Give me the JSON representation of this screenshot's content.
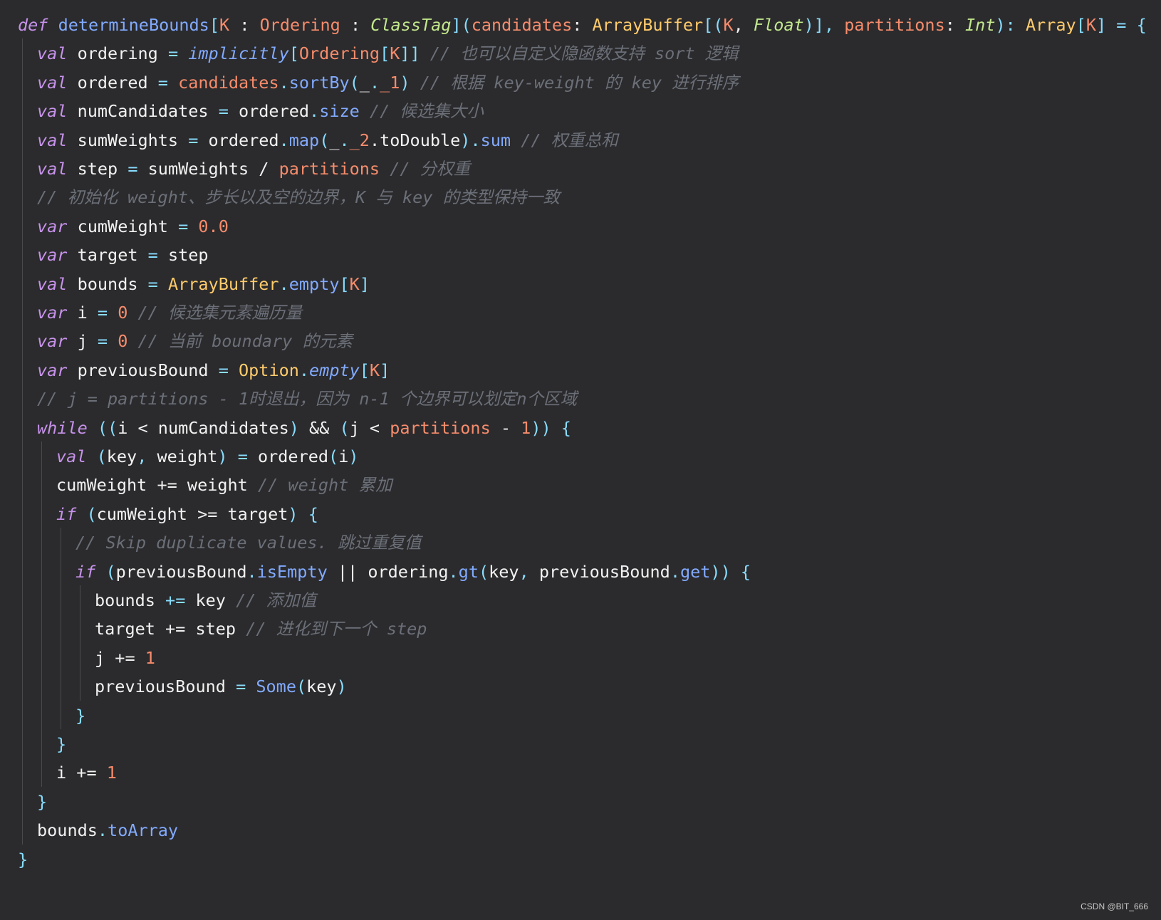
{
  "colors": {
    "background": "#2b2b2d",
    "plain": "#f2f2f2",
    "keyword": "#c792ea",
    "function": "#82aaff",
    "param": "#f78c6c",
    "type": "#ffcb6b",
    "classtag": "#c3e88d",
    "operator": "#89ddff",
    "number": "#f78c6c",
    "comment": "#6b6f78"
  },
  "code": {
    "lines": [
      {
        "indent": 0,
        "tokens": [
          {
            "t": "def",
            "c": "def"
          },
          {
            "t": " ",
            "c": "plain"
          },
          {
            "t": "determineBounds",
            "c": "fn"
          },
          {
            "t": "[",
            "c": "punc"
          },
          {
            "t": "K",
            "c": "param"
          },
          {
            "t": " : ",
            "c": "plain"
          },
          {
            "t": "Ordering",
            "c": "param"
          },
          {
            "t": " : ",
            "c": "plain"
          },
          {
            "t": "ClassTag",
            "c": "classtag"
          },
          {
            "t": "](",
            "c": "punc"
          },
          {
            "t": "candidates",
            "c": "param"
          },
          {
            "t": ": ",
            "c": "plain"
          },
          {
            "t": "ArrayBuffer",
            "c": "type"
          },
          {
            "t": "[(",
            "c": "punc"
          },
          {
            "t": "K",
            "c": "param"
          },
          {
            "t": ", ",
            "c": "plain"
          },
          {
            "t": "Float",
            "c": "classtag"
          },
          {
            "t": ")], ",
            "c": "punc"
          },
          {
            "t": "partitions",
            "c": "param"
          },
          {
            "t": ": ",
            "c": "plain"
          },
          {
            "t": "Int",
            "c": "classtag"
          },
          {
            "t": "): ",
            "c": "punc"
          },
          {
            "t": "Array",
            "c": "type"
          },
          {
            "t": "[",
            "c": "punc"
          },
          {
            "t": "K",
            "c": "param"
          },
          {
            "t": "] = {",
            "c": "punc"
          }
        ]
      },
      {
        "indent": 1,
        "tokens": [
          {
            "t": "val",
            "c": "keyword"
          },
          {
            "t": " ordering ",
            "c": "plain"
          },
          {
            "t": "=",
            "c": "op"
          },
          {
            "t": " ",
            "c": "plain"
          },
          {
            "t": "implicitly",
            "c": "methodi"
          },
          {
            "t": "[",
            "c": "punc"
          },
          {
            "t": "Ordering",
            "c": "param"
          },
          {
            "t": "[",
            "c": "punc"
          },
          {
            "t": "K",
            "c": "param"
          },
          {
            "t": "]]",
            "c": "punc"
          },
          {
            "t": " // 也可以自定义隐函数支持 sort 逻辑",
            "c": "comment"
          }
        ]
      },
      {
        "indent": 1,
        "tokens": [
          {
            "t": "val",
            "c": "keyword"
          },
          {
            "t": " ordered ",
            "c": "plain"
          },
          {
            "t": "=",
            "c": "op"
          },
          {
            "t": " ",
            "c": "plain"
          },
          {
            "t": "candidates",
            "c": "param"
          },
          {
            "t": ".",
            "c": "punc"
          },
          {
            "t": "sortBy",
            "c": "method"
          },
          {
            "t": "(",
            "c": "punc"
          },
          {
            "t": "_",
            "c": "plain"
          },
          {
            "t": ".",
            "c": "punc"
          },
          {
            "t": "_1",
            "c": "number"
          },
          {
            "t": ")",
            "c": "punc"
          },
          {
            "t": " // 根据 key-weight 的 key 进行排序",
            "c": "comment"
          }
        ]
      },
      {
        "indent": 1,
        "tokens": [
          {
            "t": "val",
            "c": "keyword"
          },
          {
            "t": " numCandidates ",
            "c": "plain"
          },
          {
            "t": "=",
            "c": "op"
          },
          {
            "t": " ordered",
            "c": "plain"
          },
          {
            "t": ".",
            "c": "punc"
          },
          {
            "t": "size",
            "c": "method"
          },
          {
            "t": " // 候选集大小",
            "c": "comment"
          }
        ]
      },
      {
        "indent": 1,
        "tokens": [
          {
            "t": "val",
            "c": "keyword"
          },
          {
            "t": " sumWeights ",
            "c": "plain"
          },
          {
            "t": "=",
            "c": "op"
          },
          {
            "t": " ordered",
            "c": "plain"
          },
          {
            "t": ".",
            "c": "punc"
          },
          {
            "t": "map",
            "c": "method"
          },
          {
            "t": "(",
            "c": "punc"
          },
          {
            "t": "_",
            "c": "plain"
          },
          {
            "t": ".",
            "c": "punc"
          },
          {
            "t": "_2",
            "c": "number"
          },
          {
            "t": ".toDouble",
            "c": "plain"
          },
          {
            "t": ").",
            "c": "punc"
          },
          {
            "t": "sum",
            "c": "method"
          },
          {
            "t": " // 权重总和",
            "c": "comment"
          }
        ]
      },
      {
        "indent": 1,
        "tokens": [
          {
            "t": "val",
            "c": "keyword"
          },
          {
            "t": " step ",
            "c": "plain"
          },
          {
            "t": "=",
            "c": "op"
          },
          {
            "t": " sumWeights / ",
            "c": "plain"
          },
          {
            "t": "partitions",
            "c": "param"
          },
          {
            "t": " // 分权重",
            "c": "comment"
          }
        ]
      },
      {
        "indent": 1,
        "tokens": [
          {
            "t": "// 初始化 weight、步长以及空的边界，K 与 key 的类型保持一致",
            "c": "comment"
          }
        ]
      },
      {
        "indent": 1,
        "tokens": [
          {
            "t": "var",
            "c": "keyword"
          },
          {
            "t": " cumWeight ",
            "c": "plain"
          },
          {
            "t": "=",
            "c": "op"
          },
          {
            "t": " ",
            "c": "plain"
          },
          {
            "t": "0.0",
            "c": "number"
          }
        ]
      },
      {
        "indent": 1,
        "tokens": [
          {
            "t": "var",
            "c": "keyword"
          },
          {
            "t": " target ",
            "c": "plain"
          },
          {
            "t": "=",
            "c": "op"
          },
          {
            "t": " step",
            "c": "plain"
          }
        ]
      },
      {
        "indent": 1,
        "tokens": [
          {
            "t": "val",
            "c": "keyword"
          },
          {
            "t": " bounds ",
            "c": "plain"
          },
          {
            "t": "=",
            "c": "op"
          },
          {
            "t": " ",
            "c": "plain"
          },
          {
            "t": "ArrayBuffer",
            "c": "type"
          },
          {
            "t": ".",
            "c": "punc"
          },
          {
            "t": "empty",
            "c": "method"
          },
          {
            "t": "[",
            "c": "punc"
          },
          {
            "t": "K",
            "c": "param"
          },
          {
            "t": "]",
            "c": "punc"
          }
        ]
      },
      {
        "indent": 1,
        "tokens": [
          {
            "t": "var",
            "c": "keyword"
          },
          {
            "t": " i ",
            "c": "plain"
          },
          {
            "t": "=",
            "c": "op"
          },
          {
            "t": " ",
            "c": "plain"
          },
          {
            "t": "0",
            "c": "number"
          },
          {
            "t": " // 候选集元素遍历量",
            "c": "comment"
          }
        ]
      },
      {
        "indent": 1,
        "tokens": [
          {
            "t": "var",
            "c": "keyword"
          },
          {
            "t": " j ",
            "c": "plain"
          },
          {
            "t": "=",
            "c": "op"
          },
          {
            "t": " ",
            "c": "plain"
          },
          {
            "t": "0",
            "c": "number"
          },
          {
            "t": " // 当前 boundary 的元素",
            "c": "comment"
          }
        ]
      },
      {
        "indent": 1,
        "tokens": [
          {
            "t": "var",
            "c": "keyword"
          },
          {
            "t": " previousBound ",
            "c": "plain"
          },
          {
            "t": "=",
            "c": "op"
          },
          {
            "t": " ",
            "c": "plain"
          },
          {
            "t": "Option",
            "c": "type"
          },
          {
            "t": ".",
            "c": "punc"
          },
          {
            "t": "empty",
            "c": "methodi"
          },
          {
            "t": "[",
            "c": "punc"
          },
          {
            "t": "K",
            "c": "param"
          },
          {
            "t": "]",
            "c": "punc"
          }
        ]
      },
      {
        "indent": 1,
        "tokens": [
          {
            "t": "// j = partitions - 1时退出，因为 n-1 个边界可以划定n个区域",
            "c": "comment"
          }
        ]
      },
      {
        "indent": 1,
        "tokens": [
          {
            "t": "while",
            "c": "keyword"
          },
          {
            "t": " ((",
            "c": "punc"
          },
          {
            "t": "i < numCandidates",
            "c": "plain"
          },
          {
            "t": ") ",
            "c": "punc"
          },
          {
            "t": "&& ",
            "c": "plain"
          },
          {
            "t": "(",
            "c": "punc"
          },
          {
            "t": "j < ",
            "c": "plain"
          },
          {
            "t": "partitions",
            "c": "param"
          },
          {
            "t": " - ",
            "c": "plain"
          },
          {
            "t": "1",
            "c": "number"
          },
          {
            "t": ")) {",
            "c": "punc"
          }
        ]
      },
      {
        "indent": 2,
        "tokens": [
          {
            "t": "val",
            "c": "keyword"
          },
          {
            "t": " (",
            "c": "punc"
          },
          {
            "t": "key",
            "c": "plain"
          },
          {
            "t": ", ",
            "c": "punc"
          },
          {
            "t": "weight",
            "c": "plain"
          },
          {
            "t": ") ",
            "c": "punc"
          },
          {
            "t": "=",
            "c": "op"
          },
          {
            "t": " ordered",
            "c": "plain"
          },
          {
            "t": "(",
            "c": "punc"
          },
          {
            "t": "i",
            "c": "plain"
          },
          {
            "t": ")",
            "c": "punc"
          }
        ]
      },
      {
        "indent": 2,
        "tokens": [
          {
            "t": "cumWeight += weight",
            "c": "plain"
          },
          {
            "t": " // weight 累加",
            "c": "comment"
          }
        ]
      },
      {
        "indent": 2,
        "tokens": [
          {
            "t": "if",
            "c": "keyword"
          },
          {
            "t": " (",
            "c": "punc"
          },
          {
            "t": "cumWeight >= target",
            "c": "plain"
          },
          {
            "t": ") {",
            "c": "punc"
          }
        ]
      },
      {
        "indent": 3,
        "tokens": [
          {
            "t": "// Skip duplicate values. 跳过重复值",
            "c": "comment"
          }
        ]
      },
      {
        "indent": 3,
        "tokens": [
          {
            "t": "if",
            "c": "keyword"
          },
          {
            "t": " (",
            "c": "punc"
          },
          {
            "t": "previousBound",
            "c": "plain"
          },
          {
            "t": ".",
            "c": "punc"
          },
          {
            "t": "isEmpty",
            "c": "method"
          },
          {
            "t": " || ordering",
            "c": "plain"
          },
          {
            "t": ".",
            "c": "punc"
          },
          {
            "t": "gt",
            "c": "method"
          },
          {
            "t": "(",
            "c": "punc"
          },
          {
            "t": "key",
            "c": "plain"
          },
          {
            "t": ", ",
            "c": "punc"
          },
          {
            "t": "previousBound",
            "c": "plain"
          },
          {
            "t": ".",
            "c": "punc"
          },
          {
            "t": "get",
            "c": "method"
          },
          {
            "t": ")) {",
            "c": "punc"
          }
        ]
      },
      {
        "indent": 4,
        "tokens": [
          {
            "t": "bounds ",
            "c": "plain"
          },
          {
            "t": "+=",
            "c": "op"
          },
          {
            "t": " key",
            "c": "plain"
          },
          {
            "t": " // 添加值",
            "c": "comment"
          }
        ]
      },
      {
        "indent": 4,
        "tokens": [
          {
            "t": "target += step",
            "c": "plain"
          },
          {
            "t": " // 进化到下一个 step",
            "c": "comment"
          }
        ]
      },
      {
        "indent": 4,
        "tokens": [
          {
            "t": "j += ",
            "c": "plain"
          },
          {
            "t": "1",
            "c": "number"
          }
        ]
      },
      {
        "indent": 4,
        "tokens": [
          {
            "t": "previousBound ",
            "c": "plain"
          },
          {
            "t": "=",
            "c": "op"
          },
          {
            "t": " ",
            "c": "plain"
          },
          {
            "t": "Some",
            "c": "method"
          },
          {
            "t": "(",
            "c": "punc"
          },
          {
            "t": "key",
            "c": "plain"
          },
          {
            "t": ")",
            "c": "punc"
          }
        ]
      },
      {
        "indent": 3,
        "tokens": [
          {
            "t": "}",
            "c": "punc"
          }
        ]
      },
      {
        "indent": 2,
        "tokens": [
          {
            "t": "}",
            "c": "punc"
          }
        ]
      },
      {
        "indent": 2,
        "tokens": [
          {
            "t": "i += ",
            "c": "plain"
          },
          {
            "t": "1",
            "c": "number"
          }
        ]
      },
      {
        "indent": 1,
        "tokens": [
          {
            "t": "}",
            "c": "punc"
          }
        ]
      },
      {
        "indent": 1,
        "tokens": [
          {
            "t": "bounds",
            "c": "plain"
          },
          {
            "t": ".",
            "c": "punc"
          },
          {
            "t": "toArray",
            "c": "method"
          }
        ]
      },
      {
        "indent": 0,
        "tokens": [
          {
            "t": "}",
            "c": "punc"
          }
        ]
      }
    ]
  },
  "watermark": "CSDN @BIT_666"
}
